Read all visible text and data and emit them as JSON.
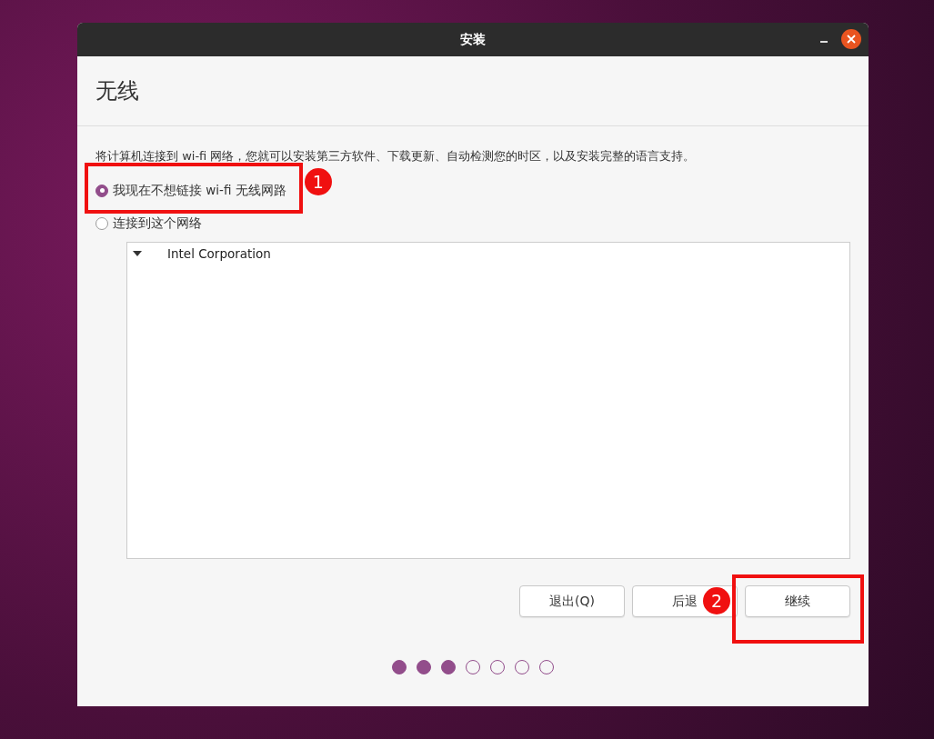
{
  "window": {
    "title": "安装"
  },
  "page_title": "无线",
  "description": "将计算机连接到 wi-fi 网络，您就可以安装第三方软件、下载更新、自动检测您的时区，以及安装完整的语言支持。",
  "options": [
    {
      "label": "我现在不想链接 wi-fi 无线网路",
      "selected": true,
      "annotation": "1"
    },
    {
      "label": "连接到这个网络",
      "selected": false
    }
  ],
  "networks": [
    {
      "name": "Intel Corporation",
      "expanded": true
    }
  ],
  "buttons": [
    {
      "label": "退出(Q)"
    },
    {
      "label": "后退",
      "annotation": "2"
    },
    {
      "label": "继续",
      "highlighted": true
    }
  ],
  "steps": [
    {
      "done": true
    },
    {
      "done": true
    },
    {
      "done": true
    },
    {
      "done": false
    },
    {
      "done": false
    },
    {
      "done": false
    },
    {
      "done": false
    }
  ]
}
